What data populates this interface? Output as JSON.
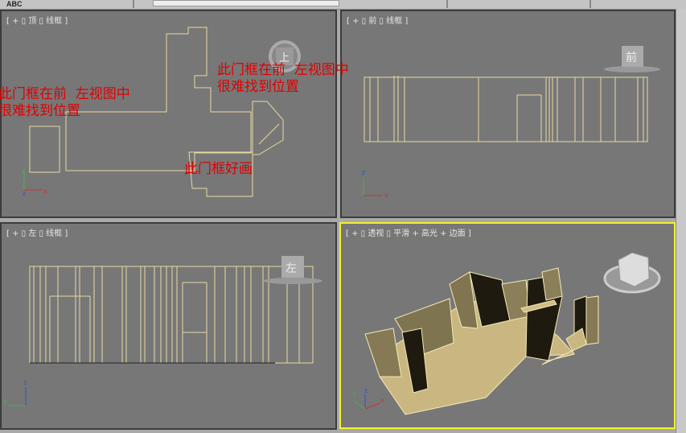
{
  "toolbar": {
    "text_label": "ABC"
  },
  "viewports": [
    {
      "id": "top",
      "label": "[ + ▯ 顶 ▯ 线框 ]",
      "cube": "上",
      "active": false
    },
    {
      "id": "front",
      "label": "[ + ▯ 前 ▯ 线框 ]",
      "cube": "前",
      "active": false
    },
    {
      "id": "left",
      "label": "[ + ▯ 左 ▯ 线框 ]",
      "cube": "左",
      "active": false
    },
    {
      "id": "perspective",
      "label": "[ + ▯ 透视 ▯ 平滑 + 高光 + 边面 ]",
      "cube": "",
      "active": true
    }
  ],
  "annotations": {
    "left_note": "此门框在前  左视图中\n很难找到位置",
    "right_note": "此门框在前  左视图中\n很难找到位置",
    "easy_note": "此门框好画"
  },
  "axes": {
    "x": "x",
    "y": "y",
    "z": "z"
  },
  "colors": {
    "wire": "#e8d9a0",
    "active_border": "#f2f22a",
    "annotation": "#e00000",
    "viewport_bg": "#777777"
  }
}
